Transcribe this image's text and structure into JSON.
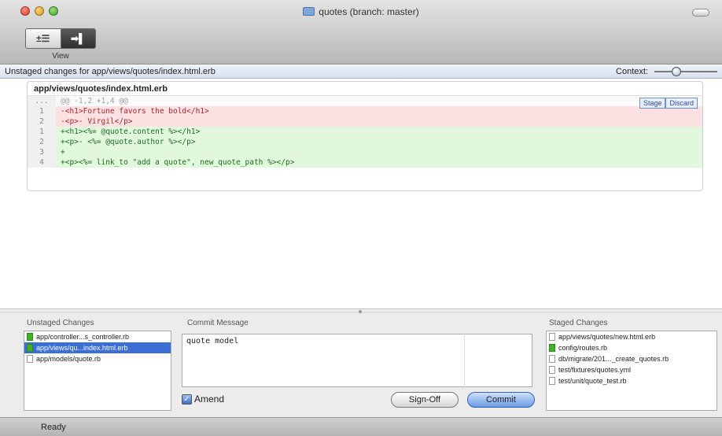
{
  "window": {
    "title": "quotes (branch: master)"
  },
  "toolbar": {
    "view_label": "View",
    "seg_a": "±☰",
    "seg_b": "➡▌"
  },
  "header": {
    "path_text": "Unstaged changes for app/views/quotes/index.html.erb",
    "context_label": "Context:",
    "context_level": 0.33
  },
  "diff": {
    "file": "app/views/quotes/index.html.erb",
    "stage_label": "Stage",
    "discard_label": "Discard",
    "lines": [
      {
        "kind": "hunk",
        "num": "...   ...",
        "text": "@@ -1,2 +1,4 @@"
      },
      {
        "kind": "del",
        "num": "1",
        "text": "-<h1>Fortune favors the bold</h1>"
      },
      {
        "kind": "del",
        "num": "2",
        "text": "-<p>- Virgil</p>"
      },
      {
        "kind": "add",
        "num": "1",
        "text": "+<h1><%= @quote.content %></h1>"
      },
      {
        "kind": "add",
        "num": "2",
        "text": "+<p>- <%= @quote.author %></p>"
      },
      {
        "kind": "add",
        "num": "3",
        "text": "+"
      },
      {
        "kind": "add",
        "num": "4",
        "text": "+<p><%= link_to \"add a quote\", new_quote_path %></p>"
      }
    ]
  },
  "unstaged": {
    "title": "Unstaged Changes",
    "items": [
      {
        "label": "app/controller...s_controller.rb",
        "icon": "green",
        "selected": false
      },
      {
        "label": "app/views/qu...index.html.erb",
        "icon": "green",
        "selected": true
      },
      {
        "label": "app/models/quote.rb",
        "icon": "file",
        "selected": false
      }
    ]
  },
  "commit": {
    "title": "Commit Message",
    "message": "quote model",
    "amend_label": "Amend",
    "amend_checked": true,
    "signoff_label": "Sign-Off",
    "commit_label": "Commit"
  },
  "staged": {
    "title": "Staged Changes",
    "items": [
      {
        "label": "app/views/quotes/new.html.erb",
        "icon": "file"
      },
      {
        "label": "config/routes.rb",
        "icon": "green"
      },
      {
        "label": "db/migrate/201..._create_quotes.rb",
        "icon": "file"
      },
      {
        "label": "test/fixtures/quotes.yml",
        "icon": "file"
      },
      {
        "label": "test/unit/quote_test.rb",
        "icon": "file"
      }
    ]
  },
  "status": {
    "text": "Ready"
  }
}
